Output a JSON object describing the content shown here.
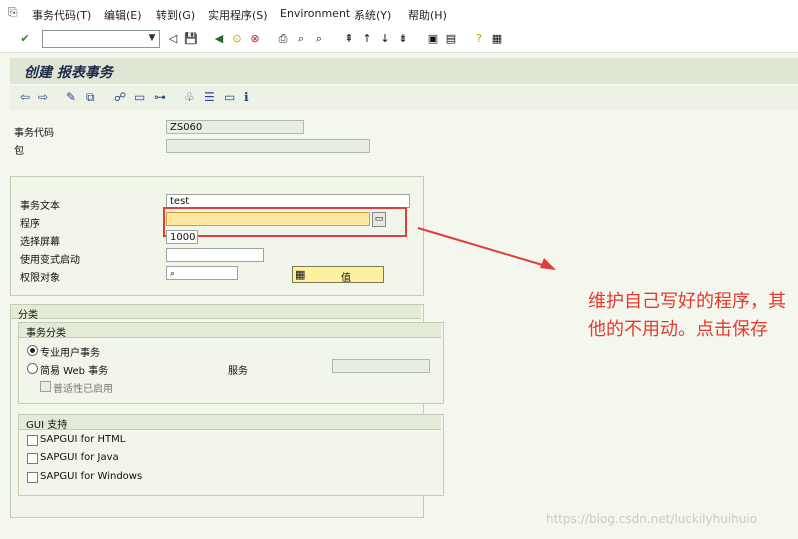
{
  "menu": {
    "items": [
      "事务代码(T)",
      "编辑(E)",
      "转到(G)",
      "实用程序(S)",
      "Environment",
      "系统(Y)",
      "帮助(H)"
    ]
  },
  "toolbar": {
    "command_value": ""
  },
  "title": "创建 报表事务",
  "fields": {
    "tcode_label": "事务代码",
    "tcode_value": "ZS060",
    "package_label": "包",
    "package_value": "",
    "text_label": "事务文本",
    "text_value": "test",
    "program_label": "程序",
    "program_value": "",
    "screen_label": "选择屏幕",
    "screen_value": "1000",
    "variant_label": "使用变式启动",
    "variant_value": "",
    "authobj_label": "权限对象",
    "authobj_value": "",
    "value_button": "值"
  },
  "classification": {
    "section_title": "分类",
    "group_title": "事务分类",
    "options": [
      "专业用户事务",
      "简易 Web 事务"
    ],
    "selected": "专业用户事务",
    "service_label": "服务",
    "service_value": "",
    "pervasive_label": "普适性已启用"
  },
  "gui": {
    "group_title": "GUI 支持",
    "options": [
      "SAPGUI for HTML",
      "SAPGUI for Java",
      "SAPGUI for Windows"
    ]
  },
  "annotation": "维护自己写好的程序，其他的不用动。点击保存",
  "watermark": "https://blog.csdn.net/luckilyhuihuio",
  "colors": {
    "highlight_box": "#e23c3c",
    "program_field": "#fde9a0",
    "annotation": "#e8382e"
  }
}
